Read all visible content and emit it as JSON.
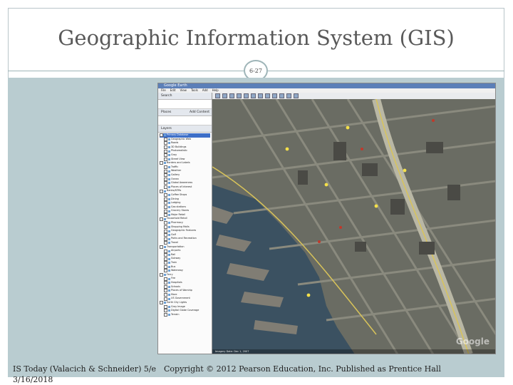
{
  "slide": {
    "title": "Geographic Information System (GIS)",
    "page_number": "6-27",
    "footer_left": "IS Today (Valacich & Schneider) 5/e",
    "footer_date": "3/16/2018",
    "footer_center": "Copyright © 2012 Pearson Education, Inc. Published as Prentice Hall"
  },
  "colors": {
    "band": "#b9ccd0",
    "rule": "#9fb5b8",
    "water": "#3b5161",
    "land": "#6a6c63"
  },
  "google_earth": {
    "window_title": "Google Earth",
    "menu": [
      "File",
      "Edit",
      "View",
      "Tools",
      "Add",
      "Help"
    ],
    "search_label": "Search",
    "places_label": "Places",
    "add_content_label": "Add Content",
    "layers_label": "Layers",
    "layers": [
      "Primary Database",
      "Geographic Web",
      "Roads",
      "3D Buildings",
      "Photorealistic",
      "Gray",
      "Street View",
      "Borders and Labels",
      "Traffic",
      "Weather",
      "Gallery",
      "Ocean",
      "Global Awareness",
      "Places of Interest",
      "Banks/ATMs",
      "Coffee Shops",
      "Dining",
      "Lodging",
      "Gas stations",
      "Grocery Stores",
      "Major Retail",
      "Household Retail",
      "Pharmacy",
      "Shopping Malls",
      "Geographic Features",
      "Golf",
      "Parks and Recreation",
      "Travel",
      "Transportation",
      "Airports",
      "Rail",
      "Subway",
      "Train",
      "Bus",
      "Waterway",
      "Ferry",
      "Fire",
      "Hospitals",
      "Schools",
      "Places of Worship",
      "More",
      "US Government",
      "Earth City Lights",
      "Gray Image",
      "Digital Globe Coverage",
      "Terrain"
    ],
    "selected_layer": "Primary Database",
    "status_text": "Imagery Date: Dec 1, 2007",
    "watermark": "Google"
  }
}
